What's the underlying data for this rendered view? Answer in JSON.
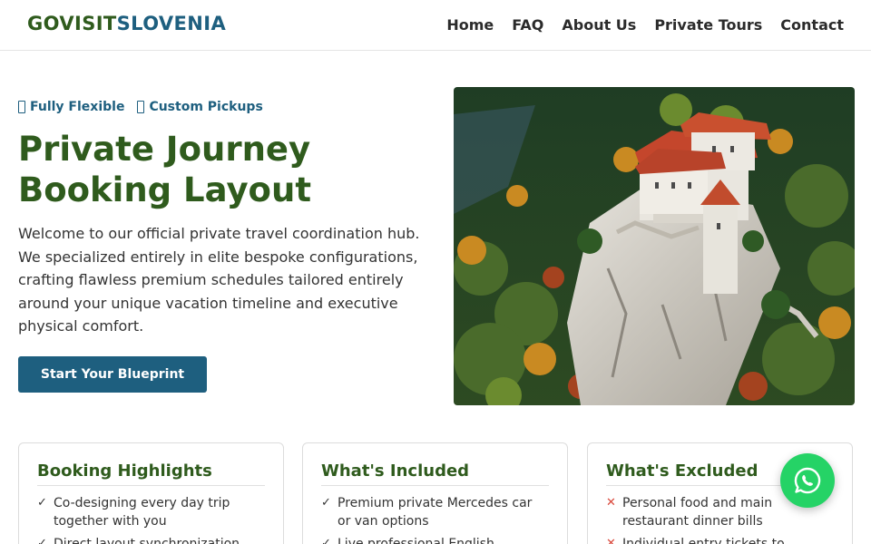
{
  "nav": {
    "logo_part1": "GOVISIT",
    "logo_part2": "SLOVENIA",
    "links": [
      "Home",
      "FAQ",
      "About Us",
      "Private Tours",
      "Contact"
    ]
  },
  "hero": {
    "tags": [
      {
        "icon": "tofu-glyph-icon",
        "label": "Fully Flexible"
      },
      {
        "icon": "tofu-glyph-icon",
        "label": "Custom Pickups"
      }
    ],
    "title": "Private Journey Booking Layout",
    "description": "Welcome to our official private travel coordination hub. We specialized entirely in elite bespoke configurations, crafting flawless premium schedules tailored entirely around your unique vacation timeline and executive physical comfort.",
    "cta_label": "Start Your Blueprint",
    "image_subject": "Lake Bled castle on a forested cliff"
  },
  "cards": [
    {
      "title": "Booking Highlights",
      "marker": "✓",
      "items": [
        "Co-designing every day trip together with you",
        "Direct layout synchronization"
      ]
    },
    {
      "title": "What's Included",
      "marker": "✓",
      "items": [
        "Premium private Mercedes car or van options",
        "Live professional English"
      ]
    },
    {
      "title": "What's Excluded",
      "marker": "✕",
      "items": [
        "Personal food and main restaurant dinner bills",
        "Individual entry tickets to"
      ]
    }
  ],
  "colors": {
    "brand_green": "#2f5b1d",
    "brand_blue": "#1e5f7f",
    "whatsapp_green": "#25d366",
    "exclude_red": "#d9473a"
  },
  "floating": {
    "icon": "whatsapp-icon"
  }
}
